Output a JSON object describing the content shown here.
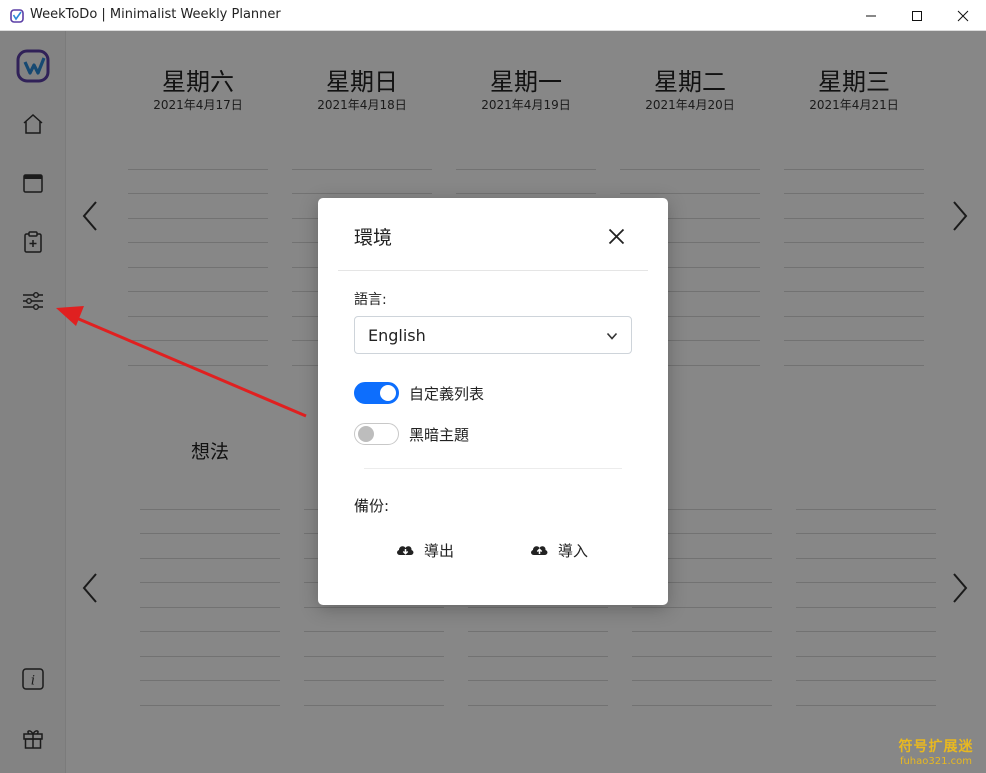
{
  "window": {
    "title": "WeekToDo | Minimalist Weekly Planner",
    "controls": [
      "minimize-icon",
      "maximize-icon",
      "close-icon"
    ]
  },
  "sidebar": {
    "items": [
      {
        "icon": "app-logo-icon"
      },
      {
        "icon": "home-icon"
      },
      {
        "icon": "calendar-icon"
      },
      {
        "icon": "clipboard-plus-icon"
      },
      {
        "icon": "settings-sliders-icon"
      },
      {
        "icon": "info-icon"
      },
      {
        "icon": "gift-icon"
      }
    ]
  },
  "days": [
    {
      "name": "星期六",
      "date": "2021年4月17日"
    },
    {
      "name": "星期日",
      "date": "2021年4月18日"
    },
    {
      "name": "星期一",
      "date": "2021年4月19日"
    },
    {
      "name": "星期二",
      "date": "2021年4月20日"
    },
    {
      "name": "星期三",
      "date": "2021年4月21日"
    }
  ],
  "custom_list": {
    "title": "想法"
  },
  "modal": {
    "title": "環境",
    "language_label": "語言:",
    "language_value": "English",
    "custom_lists_label": "自定義列表",
    "custom_lists_on": true,
    "dark_theme_label": "黑暗主題",
    "dark_theme_on": false,
    "backup_label": "備份:",
    "export_label": "導出",
    "import_label": "導入"
  },
  "watermark": {
    "line1": "符号扩展迷",
    "line2": "fuhao321.com"
  },
  "colors": {
    "accent": "#0d6efd",
    "annotation_arrow": "#e02020",
    "watermark": "#e8b820"
  }
}
